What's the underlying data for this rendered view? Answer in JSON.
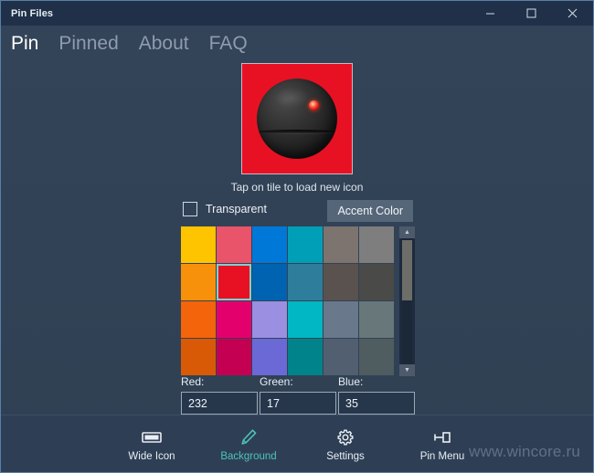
{
  "window": {
    "title": "Pin Files",
    "controls": [
      {
        "name": "minimize",
        "glyph": "minimize-icon"
      },
      {
        "name": "maximize",
        "glyph": "maximize-icon"
      },
      {
        "name": "close",
        "glyph": "close-icon"
      }
    ]
  },
  "tabs": [
    {
      "label": "Pin",
      "active": true
    },
    {
      "label": "Pinned",
      "active": false
    },
    {
      "label": "About",
      "active": false
    },
    {
      "label": "FAQ",
      "active": false
    }
  ],
  "tile": {
    "caption": "Tap on tile to load new icon",
    "background_color": "#e81123",
    "icon_name": "mine-sphere-icon"
  },
  "controls": {
    "transparent_label": "Transparent",
    "transparent_checked": false,
    "accent_color_label": "Accent Color"
  },
  "palette": {
    "selected_index": 7,
    "rows": [
      [
        "#ffc400",
        "#e9546b",
        "#0078d7",
        "#009fb8",
        "#7d736f",
        "#7e7e7e"
      ],
      [
        "#f7910b",
        "#e81123",
        "#0063b1",
        "#2e7d9a",
        "#5a524e",
        "#4a4a48"
      ],
      [
        "#f4640a",
        "#e3006d",
        "#9a8fe0",
        "#00b7c3",
        "#69788a",
        "#68777a"
      ],
      [
        "#d95a06",
        "#c30052",
        "#6b69d6",
        "#00838a",
        "#515f71",
        "#4f5c60"
      ],
      [
        "#d4510a",
        "#c4268f",
        "#8a7fd4",
        "#00a58e",
        "#8a9a97",
        "#8a9a82"
      ]
    ]
  },
  "rgb": {
    "red": {
      "label": "Red:",
      "value": "232"
    },
    "green": {
      "label": "Green:",
      "value": "17"
    },
    "blue": {
      "label": "Blue:",
      "value": "35"
    }
  },
  "bottom_bar": {
    "items": [
      {
        "label": "Wide Icon",
        "icon": "wide-tile-icon",
        "active": false
      },
      {
        "label": "Background",
        "icon": "pencil-icon",
        "active": true
      },
      {
        "label": "Settings",
        "icon": "gear-icon",
        "active": false
      },
      {
        "label": "Pin Menu",
        "icon": "pin-icon",
        "active": false
      }
    ]
  },
  "watermark": "www.wincore.ru",
  "colors": {
    "accent": "#4ec3b8",
    "window_bg": "#32435a",
    "titlebar_bg": "#1f3048",
    "selected_swatch": "#e81123"
  }
}
